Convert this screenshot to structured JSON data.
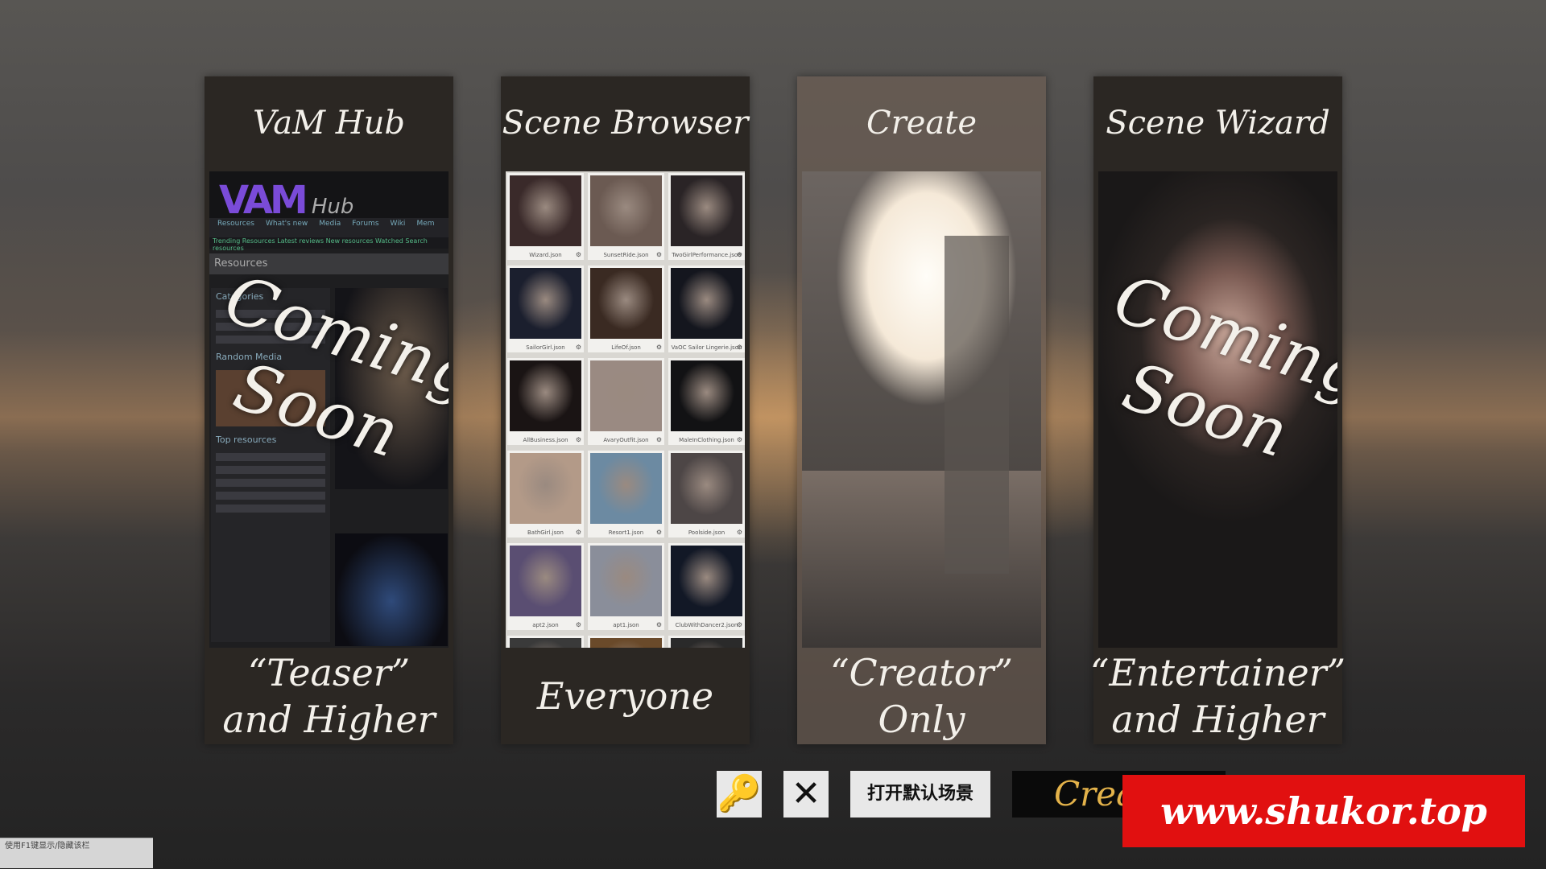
{
  "cards": [
    {
      "title": "VaM Hub",
      "overlay": [
        "Coming",
        "Soon"
      ],
      "foot": [
        "“Teaser”",
        "and Higher"
      ]
    },
    {
      "title": "Scene Browser",
      "foot": [
        "Everyone"
      ]
    },
    {
      "title": "Create",
      "foot": [
        "“Creator”",
        "Only"
      ]
    },
    {
      "title": "Scene Wizard",
      "overlay": [
        "Coming",
        "Soon"
      ],
      "foot": [
        "“Entertainer”",
        "and Higher"
      ]
    }
  ],
  "hub_preview": {
    "logo_main": "VAM",
    "logo_hub": "Hub",
    "nav": [
      "Resources",
      "What's new",
      "Media",
      "Forums",
      "Wiki",
      "Mem"
    ],
    "sub": "Trending Resources   Latest reviews   New resources   Watched   Search resources",
    "section": "Resources",
    "categories": "Categories",
    "random_media": "Random Media",
    "top_resources": "Top resources"
  },
  "scene_tiles": [
    {
      "label": "Wizard.json",
      "color": "#3a2a2a"
    },
    {
      "label": "SunsetRide.json",
      "color": "#6b5a52"
    },
    {
      "label": "TwoGirlPerformance.json",
      "color": "#2a2426"
    },
    {
      "label": "SailorGirl.json",
      "color": "#1b1f2e"
    },
    {
      "label": "LifeOf.json",
      "color": "#3a2a22"
    },
    {
      "label": "VaOC Sailor Lingerie.json",
      "color": "#14161e"
    },
    {
      "label": "AllBusiness.json",
      "color": "#1a1414"
    },
    {
      "label": "AvaryOutfit.json",
      "color": "#9a8a82"
    },
    {
      "label": "MaleInClothing.json",
      "color": "#121214"
    },
    {
      "label": "BathGirl.json",
      "color": "#b39a88"
    },
    {
      "label": "Resort1.json",
      "color": "#6c8aa2"
    },
    {
      "label": "Poolside.json",
      "color": "#4d4646"
    },
    {
      "label": "apt2.json",
      "color": "#5a4e72"
    },
    {
      "label": "apt1.json",
      "color": "#8a8e9a"
    },
    {
      "label": "ClubWithDancer2.json",
      "color": "#121826"
    },
    {
      "label": "",
      "color": "#3a3a3a"
    },
    {
      "label": "",
      "color": "#6a4a2a"
    },
    {
      "label": "",
      "color": "#2a2a2a"
    }
  ],
  "bottom": {
    "key_icon": "🔑",
    "close_icon": "✕",
    "open_default_scene": "打开默认场景",
    "create_label": "Crea"
  },
  "watermark": "www.shukor.top",
  "f1_hint": "使用F1键显示/隐藏该栏"
}
